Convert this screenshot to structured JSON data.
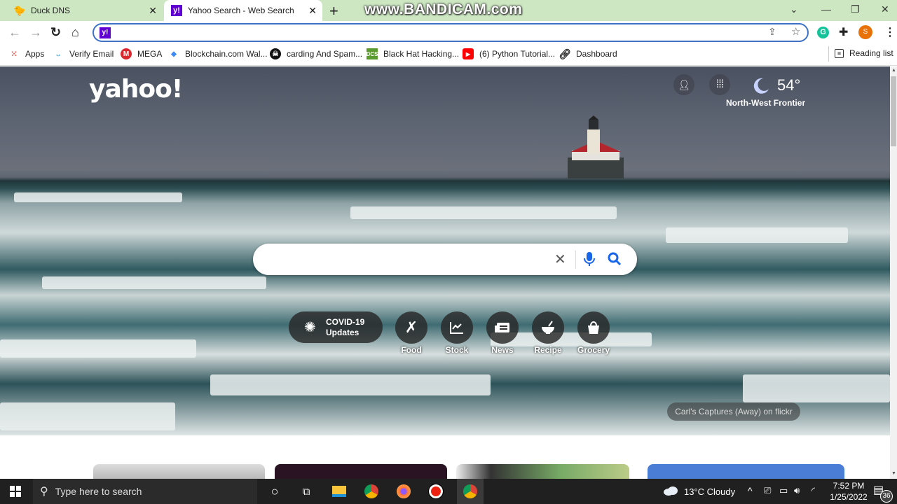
{
  "browser": {
    "tabs": [
      {
        "label": "Duck DNS",
        "favicon": "duck-icon",
        "active": false
      },
      {
        "label": "Yahoo Search - Web Search",
        "favicon": "yahoo-icon",
        "active": true
      }
    ],
    "watermark": "www.BANDICAM.com",
    "omnibox": {
      "value": "",
      "placeholder": ""
    },
    "bookmarks": [
      {
        "label": "Apps",
        "icon": "apps-grid-icon"
      },
      {
        "label": "Verify Email",
        "icon": "cisco-icon"
      },
      {
        "label": "MEGA",
        "icon": "mega-icon"
      },
      {
        "label": "Blockchain.com Wal...",
        "icon": "blockchain-icon"
      },
      {
        "label": "carding And Spam...",
        "icon": "skull-icon"
      },
      {
        "label": "Black Hat Hacking...",
        "icon": "dcs-icon"
      },
      {
        "label": "(6) Python Tutorial...",
        "icon": "youtube-icon"
      },
      {
        "label": "Dashboard",
        "icon": "link-icon"
      }
    ],
    "reading_list": "Reading list",
    "profile_initial": "S"
  },
  "yahoo": {
    "logo": "yahoo!",
    "weather": {
      "temp": "54°",
      "location": "North-West Frontier"
    },
    "search": {
      "value": "",
      "placeholder": ""
    },
    "covid": {
      "line1": "COVID-19",
      "line2": "Updates"
    },
    "quick_links": [
      {
        "label": "Food",
        "icon": "fork-knife-icon"
      },
      {
        "label": "Stock",
        "icon": "chart-icon"
      },
      {
        "label": "News",
        "icon": "newspaper-icon"
      },
      {
        "label": "Recipe",
        "icon": "bowl-icon"
      },
      {
        "label": "Grocery",
        "icon": "bag-icon"
      }
    ],
    "photo_credit": "Carl's Captures (Away) on flickr"
  },
  "taskbar": {
    "search_placeholder": "Type here to search",
    "weather": "13°C  Cloudy",
    "time": "7:52 PM",
    "date": "1/25/2022",
    "notifications": "36"
  }
}
